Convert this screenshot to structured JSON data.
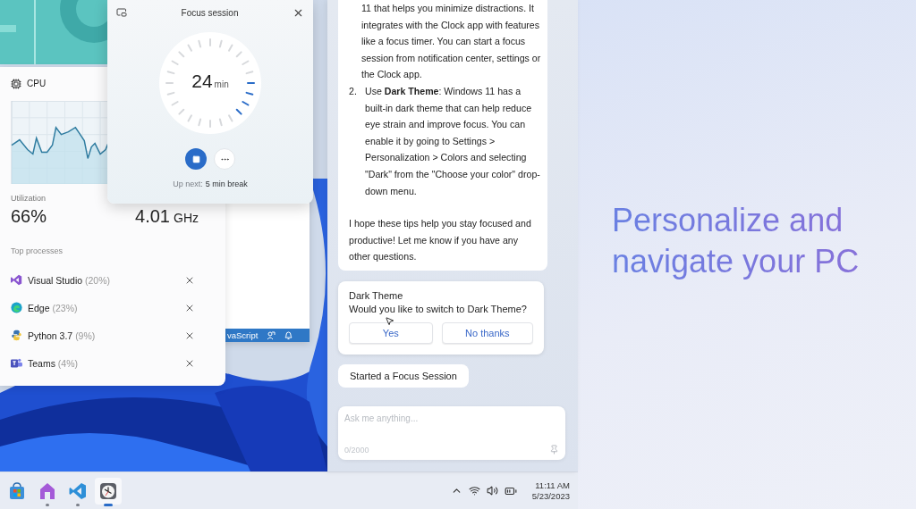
{
  "focus_session": {
    "title": "Focus session",
    "time": "24",
    "unit": "min",
    "up_next_label": "Up next:",
    "up_next_value": "5 min break"
  },
  "cpu_widget": {
    "title": "CPU",
    "utilization_label": "Utilization",
    "utilization": "66%",
    "speed": "4.01",
    "speed_unit": "GHz",
    "processes_label": "Top processes",
    "processes": [
      {
        "name": "Visual Studio",
        "share": "(20%)"
      },
      {
        "name": "Edge",
        "share": "(23%)"
      },
      {
        "name": "Python 3.7",
        "share": "(9%)"
      },
      {
        "name": "Teams",
        "share": "(4%)"
      }
    ]
  },
  "code_editor": {
    "status_text": "vaScript"
  },
  "copilot": {
    "answer": {
      "items": [
        {
          "text": "11 that helps you minimize distractions. It integrates with the Clock app with features like a focus timer. You can start a focus session from notification center, settings or the Clock app."
        },
        {
          "marker": "2.",
          "text": "Use **Dark Theme**: Windows 11 has a built-in dark theme that can help reduce eye strain and improve focus. You can enable it by going to Settings > Personalization > Colors and selecting \"Dark\" from the \"Choose your color\" drop-down menu."
        }
      ],
      "closing": "I hope these tips help you stay focused and productive! Let me know if you have any other questions."
    },
    "prompt_card": {
      "title": "Dark Theme",
      "question": "Would you like to switch to Dark Theme?",
      "buttons": [
        "Yes",
        "No thanks"
      ]
    },
    "status_message": "Started a Focus Session",
    "input": {
      "placeholder": "Ask me anything...",
      "counter": "0/2000"
    }
  },
  "taskbar": {
    "apps": [
      {
        "running": false,
        "selected": false
      },
      {
        "running": true,
        "selected": false
      },
      {
        "running": true,
        "selected": false
      },
      {
        "running": true,
        "selected": true
      }
    ],
    "time": "11:11 AM",
    "date": "5/23/2023"
  },
  "headline": "Personalize and navigate your PC"
}
